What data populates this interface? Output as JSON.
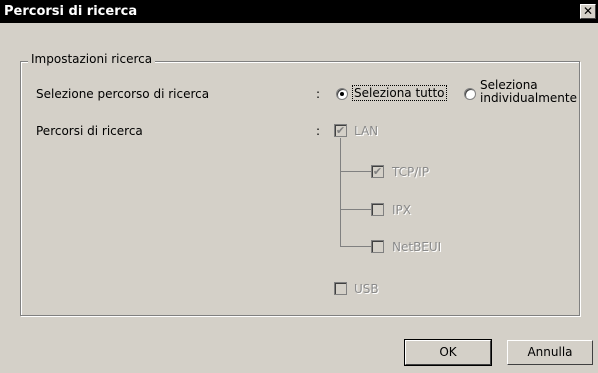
{
  "window": {
    "title": "Percorsi di ricerca",
    "close_glyph": "✕"
  },
  "group": {
    "label": "Impostazioni ricerca"
  },
  "rows": {
    "selection_label": "Selezione percorso di ricerca",
    "paths_label": "Percorsi di ricerca",
    "separator": ":"
  },
  "radios": {
    "select_all": {
      "label": "Seleziona tutto",
      "checked": true
    },
    "select_individual": {
      "label_line1": "Seleziona",
      "label_line2": "individualmente",
      "checked": false
    }
  },
  "checkboxes": {
    "lan": {
      "label": "LAN",
      "checked": true,
      "enabled": false
    },
    "tcpip": {
      "label": "TCP/IP",
      "checked": true,
      "enabled": false
    },
    "ipx": {
      "label": "IPX",
      "checked": false,
      "enabled": false
    },
    "netbeui": {
      "label": "NetBEUI",
      "checked": false,
      "enabled": false
    },
    "usb": {
      "label": "USB",
      "checked": false,
      "enabled": false
    }
  },
  "buttons": {
    "ok": "OK",
    "cancel": "Annulla"
  },
  "icons": {
    "check_mark": "✔",
    "close": "close-icon"
  }
}
